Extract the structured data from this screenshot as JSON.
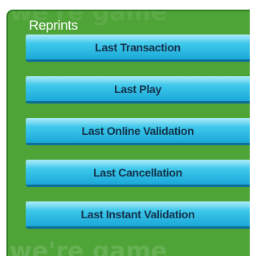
{
  "panel": {
    "title": "Reprints",
    "watermark_text": "we're game"
  },
  "buttons": [
    {
      "label": "Last Transaction"
    },
    {
      "label": "Last Play"
    },
    {
      "label": "Last Online Validation"
    },
    {
      "label": "Last Cancellation"
    },
    {
      "label": "Last Instant Validation"
    }
  ],
  "colors": {
    "panel_green": "#4fa438",
    "button_blue": "#3cc6ea",
    "button_text": "#14324a",
    "title_text": "#ffffff"
  }
}
